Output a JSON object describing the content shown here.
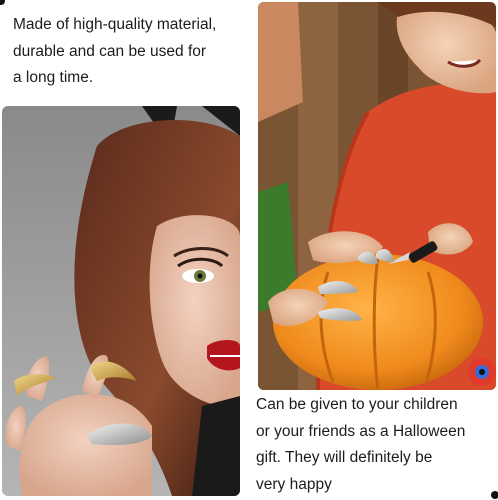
{
  "top_left_caption": {
    "lines": [
      "Made of high-quality material,",
      "durable and can be used for",
      "a long time."
    ]
  },
  "bottom_right_caption": {
    "lines": [
      "Can be given to your children",
      "or your friends as a Halloween",
      "gift. They will definitely be",
      "very happy"
    ]
  },
  "images": {
    "left": "woman-with-gold-claw-rings",
    "right": "boy-carving-pumpkin-with-claw-rings"
  },
  "colors": {
    "pumpkin": "#f08a1c",
    "sweater": "#d94a2a",
    "gold_claw": "#c9a24a",
    "silver_claw": "#c8c8c8"
  }
}
